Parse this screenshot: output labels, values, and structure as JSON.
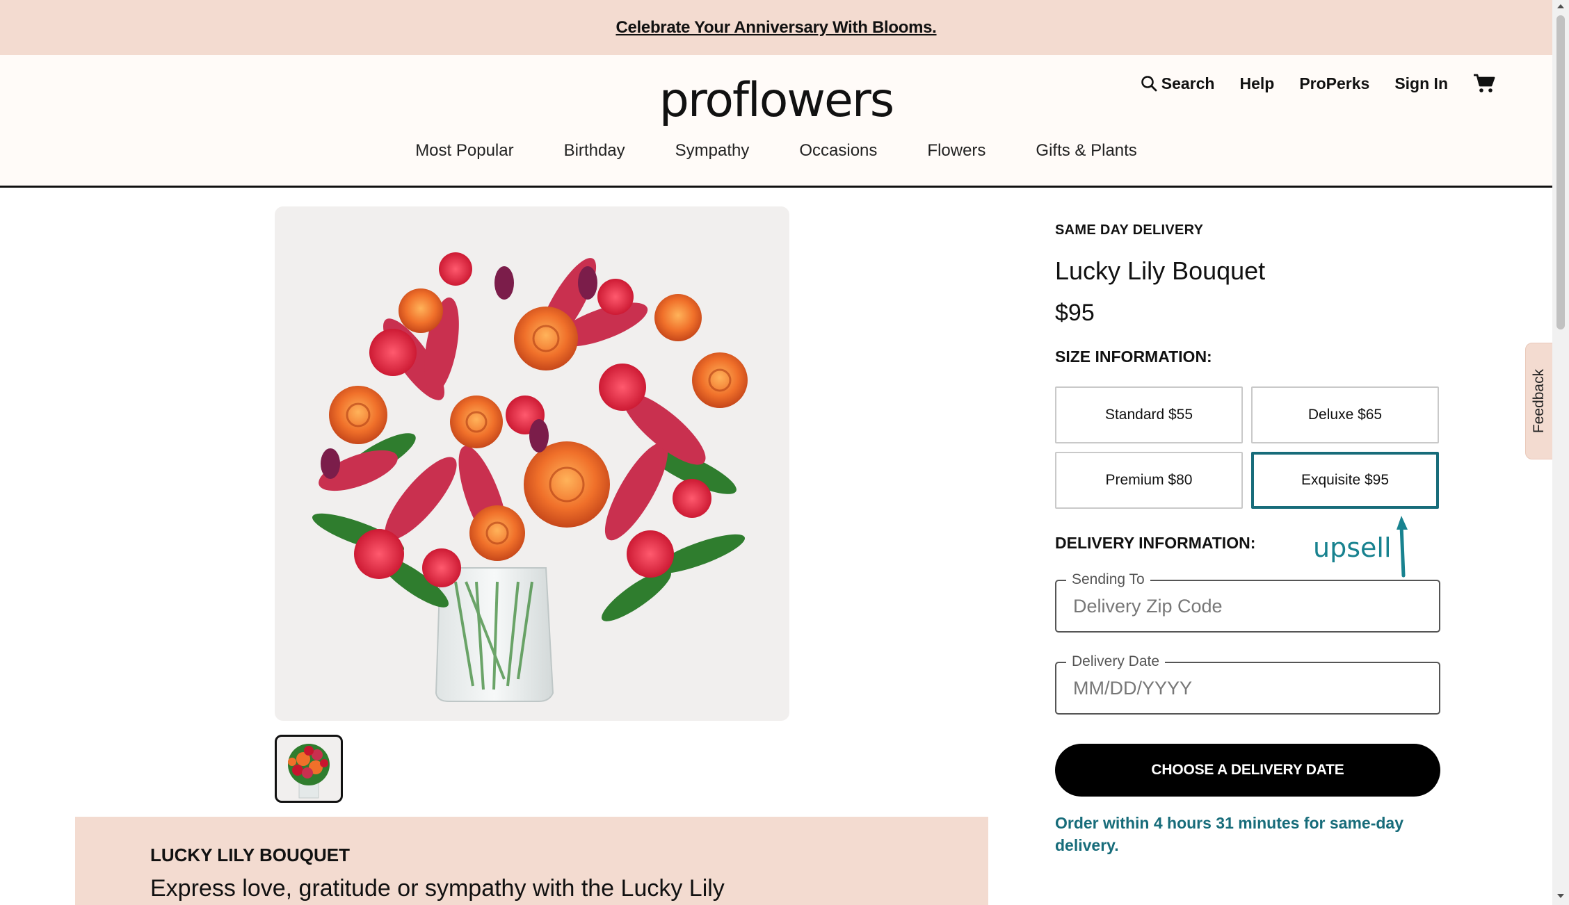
{
  "promo": {
    "text": "Celebrate Your Anniversary With Blooms."
  },
  "header": {
    "logo": "proflowers",
    "utility": {
      "search": "Search",
      "help": "Help",
      "properks": "ProPerks",
      "signin": "Sign In"
    },
    "icons": {
      "search": "search-icon",
      "cart": "cart-icon"
    }
  },
  "nav": [
    "Most Popular",
    "Birthday",
    "Sympathy",
    "Occasions",
    "Flowers",
    "Gifts & Plants"
  ],
  "product": {
    "eyebrow": "SAME DAY DELIVERY",
    "title": "Lucky Lily Bouquet",
    "price": "$95",
    "size_heading": "SIZE INFORMATION:",
    "sizes": [
      {
        "label": "Standard $55",
        "selected": false
      },
      {
        "label": "Deluxe $65",
        "selected": false
      },
      {
        "label": "Premium $80",
        "selected": false
      },
      {
        "label": "Exquisite $95",
        "selected": true
      }
    ],
    "delivery_heading": "DELIVERY INFORMATION:",
    "annotation": "upsell",
    "sending_to": {
      "label": "Sending To",
      "placeholder": "Delivery Zip Code"
    },
    "delivery_date": {
      "label": "Delivery Date",
      "placeholder": "MM/DD/YYYY"
    },
    "cta": "CHOOSE A DELIVERY DATE",
    "cutoff": "Order within 4 hours 31 minutes for same-day delivery."
  },
  "description": {
    "title": "LUCKY LILY BOUQUET",
    "text": "Express love, gratitude or sympathy with the Lucky Lily"
  },
  "feedback": {
    "label": "Feedback"
  },
  "colors": {
    "promo_bg": "#f3dbd0",
    "accent_teal": "#176c7a",
    "cta_bg": "#000000"
  }
}
